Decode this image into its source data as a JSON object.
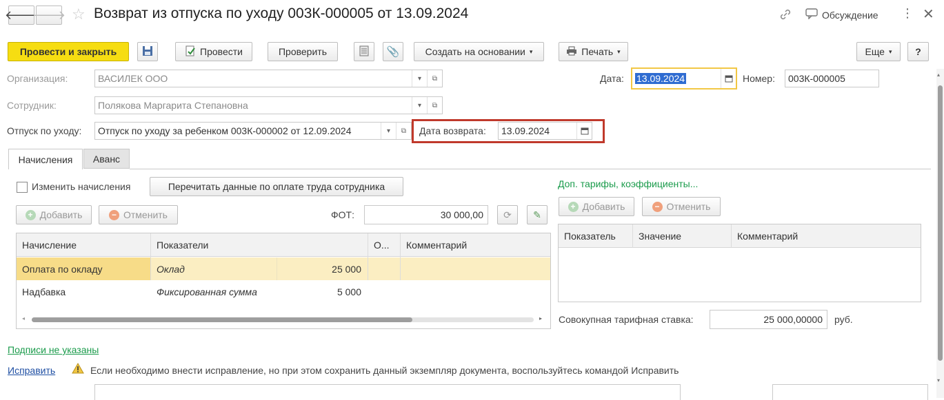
{
  "window": {
    "title": "Возврат из отпуска по уходу 003К-000005 от 13.09.2024",
    "discussion_label": "Обсуждение"
  },
  "toolbar": {
    "post_close": "Провести и закрыть",
    "post": "Провести",
    "check": "Проверить",
    "create_based": "Создать на основании",
    "print": "Печать",
    "more": "Еще",
    "help": "?"
  },
  "header": {
    "org_label": "Организация:",
    "org_value": "ВАСИЛЕК ООО",
    "date_label": "Дата:",
    "date_value": "13.09.2024",
    "number_label": "Номер:",
    "number_value": "003К-000005",
    "employee_label": "Сотрудник:",
    "employee_value": "Полякова Маргарита Степановна",
    "leave_label": "Отпуск по уходу:",
    "leave_value": "Отпуск по уходу за ребенком 003К-000002 от 12.09.2024",
    "return_date_label": "Дата возврата:",
    "return_date_value": "13.09.2024"
  },
  "tabs": [
    {
      "label": "Начисления",
      "active": true
    },
    {
      "label": "Аванс",
      "active": false
    }
  ],
  "accruals": {
    "change_checkbox_label": "Изменить начисления",
    "reread_button": "Перечитать данные по оплате труда сотрудника",
    "add_label": "Добавить",
    "cancel_label": "Отменить",
    "fot_label": "ФОТ:",
    "fot_value": "30 000,00",
    "columns": [
      "Начисление",
      "Показатели",
      "О...",
      "Комментарий"
    ],
    "rows": [
      {
        "name": "Оплата по окладу",
        "indicator": "Оклад",
        "value": "25 000"
      },
      {
        "name": "Надбавка",
        "indicator": "Фиксированная сумма",
        "value": "5 000"
      }
    ]
  },
  "tariffs": {
    "link": "Доп. тарифы, коэффициенты...",
    "add_label": "Добавить",
    "cancel_label": "Отменить",
    "columns": [
      "Показатель",
      "Значение",
      "Комментарий"
    ],
    "total_label": "Совокупная тарифная ставка:",
    "total_value": "25 000,00000",
    "currency": "руб."
  },
  "footer": {
    "signatures_link": "Подписи не указаны",
    "fix_link": "Исправить",
    "warning_text": "Если необходимо внести исправление, но при этом сохранить данный экземпляр документа, воспользуйтесь командой Исправить"
  },
  "colors": {
    "primary_button": "#f6dd12",
    "selected_row": "#fbeec2",
    "link_green": "#1a9b4b",
    "link_blue": "#1f4fa3",
    "highlight_border": "#c0392b",
    "date_focus_border": "#f2c744"
  }
}
